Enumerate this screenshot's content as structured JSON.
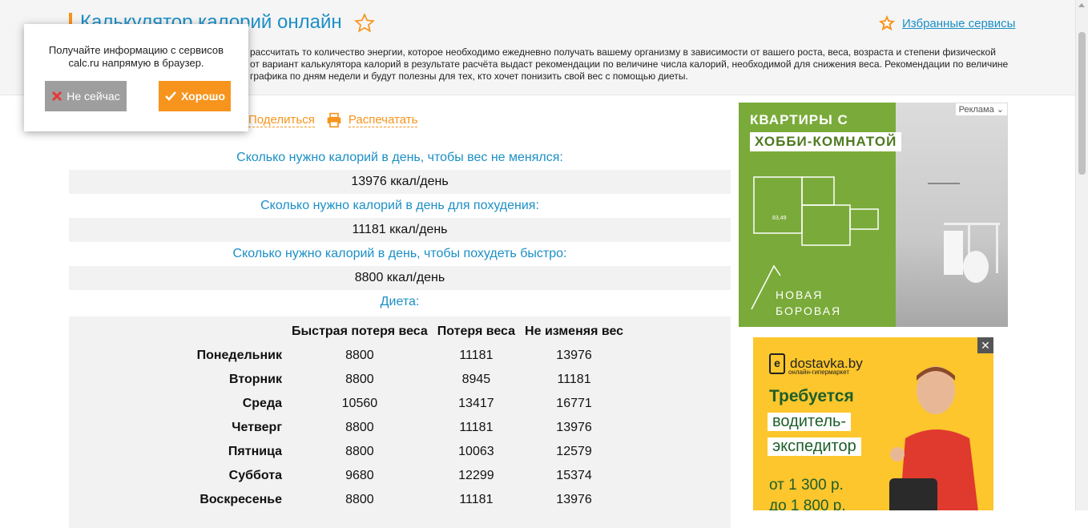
{
  "header": {
    "title": "Калькулятор калорий онлайн",
    "favorites_label": "Избранные сервисы",
    "intro_lines": [
      "рассчитать то количество энергии, которое необходимо ежедневно получать вашему организму в зависимости от вашего роста, веса, возраста и степени физической",
      "от вариант калькулятора калорий в результате расчёта выдаст рекомендации по величине числа калорий, необходимой для снижения веса. Рекомендации по величине",
      "графика по дням недели и будут полезны для тех, кто хочет понизить свой вес с помощью диеты."
    ]
  },
  "actions": {
    "share_label": "Поделиться",
    "print_label": "Распечатать"
  },
  "results": {
    "maintain_label": "Сколько нужно калорий в день, чтобы вес не менялся:",
    "maintain_value": "13976 ккал/день",
    "loss_label": "Сколько нужно калорий в день для похудения:",
    "loss_value": "11181 ккал/день",
    "fast_label": "Сколько нужно калорий в день, чтобы похудеть быстро:",
    "fast_value": "8800 ккал/день",
    "diet_label": "Диета:"
  },
  "diet_table": {
    "headers": [
      "",
      "Быстрая потеря веса",
      "Потеря веса",
      "Не изменяя вес"
    ],
    "rows": [
      {
        "day": "Понедельник",
        "fast": "8800",
        "loss": "11181",
        "keep": "13976"
      },
      {
        "day": "Вторник",
        "fast": "8800",
        "loss": "8945",
        "keep": "11181"
      },
      {
        "day": "Среда",
        "fast": "10560",
        "loss": "13417",
        "keep": "16771"
      },
      {
        "day": "Четверг",
        "fast": "8800",
        "loss": "11181",
        "keep": "13976"
      },
      {
        "day": "Пятница",
        "fast": "8800",
        "loss": "10063",
        "keep": "12579"
      },
      {
        "day": "Суббота",
        "fast": "9680",
        "loss": "12299",
        "keep": "15374"
      },
      {
        "day": "Воскресенье",
        "fast": "8800",
        "loss": "11181",
        "keep": "13976"
      }
    ]
  },
  "ad1": {
    "label": "Реклама ⌄",
    "title1": "КВАРТИРЫ С",
    "title2": "ХОББИ-КОМНАТОЙ",
    "plan_area": "83,49",
    "brand1": "НОВАЯ",
    "brand2": "БОРОВАЯ"
  },
  "ad2": {
    "close": "✕",
    "logo_letter": "e",
    "brand": "dostavka.by",
    "sub": "онлайн-гипермаркет",
    "line1": "Требуется",
    "line2": "водитель-",
    "line3": "экспедитор",
    "price1": "от 1 300 р.",
    "price2": "до 1 800 р."
  },
  "popup": {
    "text": "Получайте информацию с сервисов calc.ru напрямую в браузер.",
    "no_label": "Не сейчас",
    "yes_label": "Хорошо"
  },
  "colors": {
    "accent_orange": "#f7941d",
    "link_blue": "#1b8fc6"
  }
}
